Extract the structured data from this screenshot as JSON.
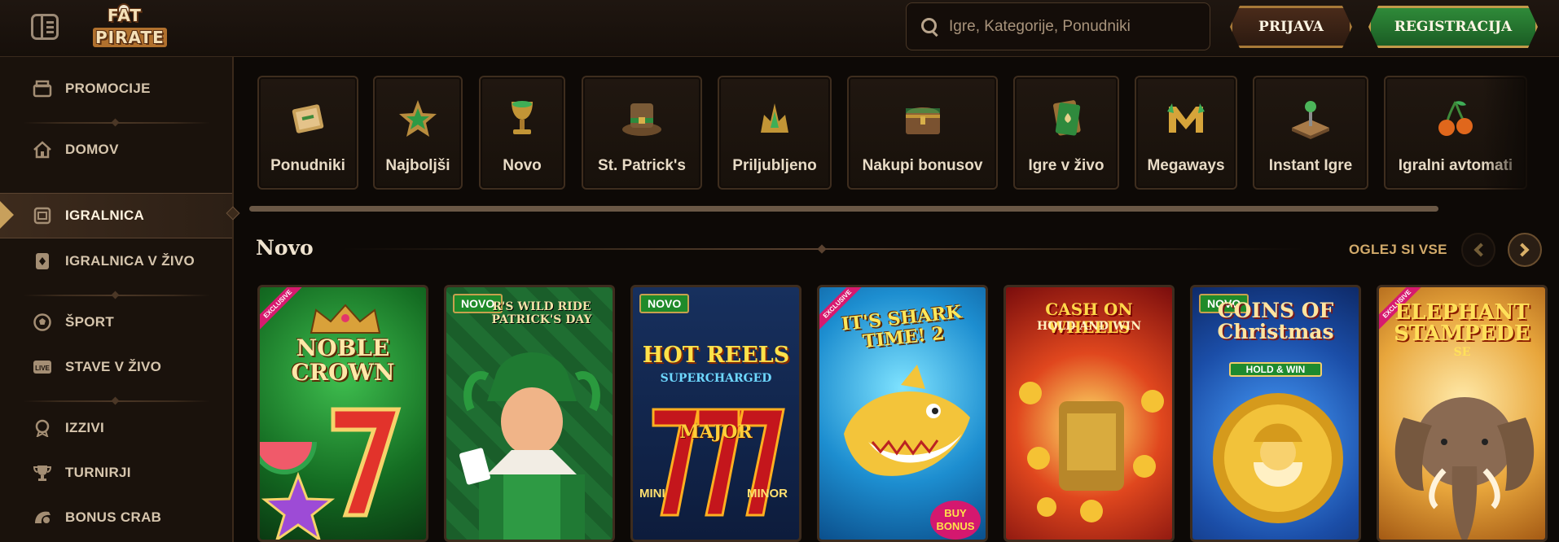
{
  "header": {
    "logo_line1": "FAT",
    "logo_line2": "PIRATE",
    "search_placeholder": "Igre, Kategorije, Ponudniki",
    "login_label": "PRIJAVA",
    "register_label": "REGISTRACIJA"
  },
  "sidebar": {
    "items": [
      {
        "label": "PROMOCIJE",
        "icon": "promotions-icon"
      },
      {
        "label": "DOMOV",
        "icon": "home-icon"
      },
      {
        "label": "IGRALNICA",
        "icon": "casino-icon",
        "active": true
      },
      {
        "label": "IGRALNICA V ŽIVO",
        "icon": "live-casino-icon"
      },
      {
        "label": "ŠPORT",
        "icon": "soccer-ball-icon"
      },
      {
        "label": "STAVE V ŽIVO",
        "icon": "live-bets-icon"
      },
      {
        "label": "IZZIVI",
        "icon": "challenges-icon"
      },
      {
        "label": "TURNIRJI",
        "icon": "trophy-icon"
      },
      {
        "label": "BONUS CRAB",
        "icon": "crab-icon"
      }
    ],
    "live_icon_text": "LIVE"
  },
  "categories": [
    {
      "label": "Ponudniki",
      "icon": "scroll-icon"
    },
    {
      "label": "Najboljši",
      "icon": "star-icon"
    },
    {
      "label": "Novo",
      "icon": "goblet-icon"
    },
    {
      "label": "St. Patrick's",
      "icon": "leprechaun-hat-icon"
    },
    {
      "label": "Priljubljeno",
      "icon": "crystal-crown-icon"
    },
    {
      "label": "Nakupi bonusov",
      "icon": "treasure-chest-icon"
    },
    {
      "label": "Igre v živo",
      "icon": "card-icon"
    },
    {
      "label": "Megaways",
      "icon": "megaways-m-icon"
    },
    {
      "label": "Instant Igre",
      "icon": "joystick-icon"
    },
    {
      "label": "Igralni avtomati",
      "icon": "cherries-icon"
    }
  ],
  "section": {
    "title": "Novo",
    "see_all": "OGLEJ SI VSE"
  },
  "games": [
    {
      "title": "NOBLE CROWN",
      "sub": "",
      "badge": "",
      "ribbon": "EXCLUSIVE"
    },
    {
      "title": "",
      "sub": "R'S WILD RIDE PATRICK'S DAY",
      "badge": "NOVO",
      "ribbon": ""
    },
    {
      "title": "HOT REELS",
      "sub": "SUPERCHARGED",
      "badge": "NOVO",
      "ribbon": "",
      "extra": [
        "MAJOR",
        "MINI",
        "MINOR"
      ]
    },
    {
      "title": "IT'S SHARK TIME! 2",
      "sub": "",
      "badge": "",
      "ribbon": "EXCLUSIVE",
      "extra": [
        "BUY BONUS"
      ]
    },
    {
      "title": "CASH ON WHEELS",
      "sub": "HOLD AND WIN",
      "badge": "",
      "ribbon": ""
    },
    {
      "title": "COINS OF Christmas",
      "sub": "HOLD & WIN",
      "badge": "NOVO",
      "ribbon": ""
    },
    {
      "title": "ELEPHANT STAMPEDE",
      "sub": "SE",
      "badge": "",
      "ribbon": "EXCLUSIVE"
    }
  ],
  "colors": {
    "accent_gold": "#d2aa6a",
    "register_green": "#2f8a39",
    "badge_green": "#1f8a2a",
    "background": "#0d0906"
  }
}
